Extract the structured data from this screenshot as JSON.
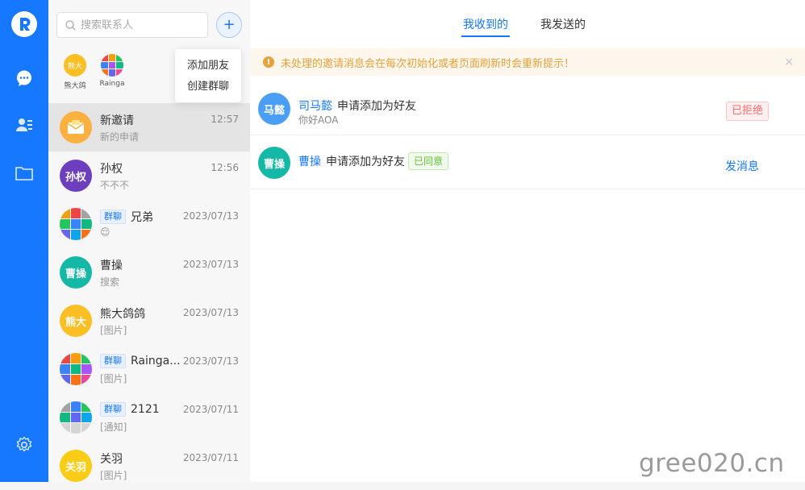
{
  "search": {
    "placeholder": "搜索联系人"
  },
  "add_button": {
    "label": "+"
  },
  "dropdown": {
    "items": [
      "添加朋友",
      "创建群聊"
    ]
  },
  "top_contacts": [
    {
      "avatar_text": "熊大",
      "name": "熊大鸽",
      "color": "#fbbf24"
    },
    {
      "avatar_text": "",
      "name": "Rainga"
    }
  ],
  "group_tag": "群聊",
  "conversations": [
    {
      "name": "新邀请",
      "time": "12:57",
      "sub": "新的申请",
      "avatar_color": "#fbb040",
      "icon": "envelope-icon"
    },
    {
      "name": "孙权",
      "time": "12:56",
      "sub": "不不不",
      "avatar_text": "孙权",
      "avatar_color": "#6d3fbe"
    },
    {
      "name": "兄弟",
      "time": "2023/07/13",
      "sub": "😌",
      "is_group": true
    },
    {
      "name": "曹操",
      "time": "2023/07/13",
      "sub": "搜索",
      "avatar_text": "曹操",
      "avatar_color": "#14b8a6"
    },
    {
      "name": "熊大鸽鸽",
      "time": "2023/07/13",
      "sub": "[图片]",
      "avatar_text": "熊大",
      "avatar_color": "#fbbf24"
    },
    {
      "name": "Rainga...",
      "time": "2023/07/13",
      "sub": "[图片]",
      "is_group": true
    },
    {
      "name": "2121",
      "time": "2023/07/11",
      "sub": "[通知]",
      "is_group": true
    },
    {
      "name": "关羽",
      "time": "2023/07/11",
      "sub": "[图片]",
      "avatar_text": "关羽",
      "avatar_color": "#facc15"
    }
  ],
  "tabs": [
    "我收到的",
    "我发送的"
  ],
  "alert": {
    "text": "未处理的邀请消息会在每次初始化或者页面刷新时会重新提示！",
    "close": "×"
  },
  "requests": [
    {
      "avatar_text": "马懿",
      "avatar_color": "#4a9ff5",
      "who": "司马懿",
      "action": "申请添加为好友",
      "sub": "你好AOA",
      "status": "已拒绝"
    },
    {
      "avatar_text": "曹操",
      "avatar_color": "#14b8a6",
      "who": "曹操",
      "action": "申请添加为好友",
      "status": "已同意",
      "link": "发消息"
    }
  ],
  "watermark": "gree020.cn"
}
